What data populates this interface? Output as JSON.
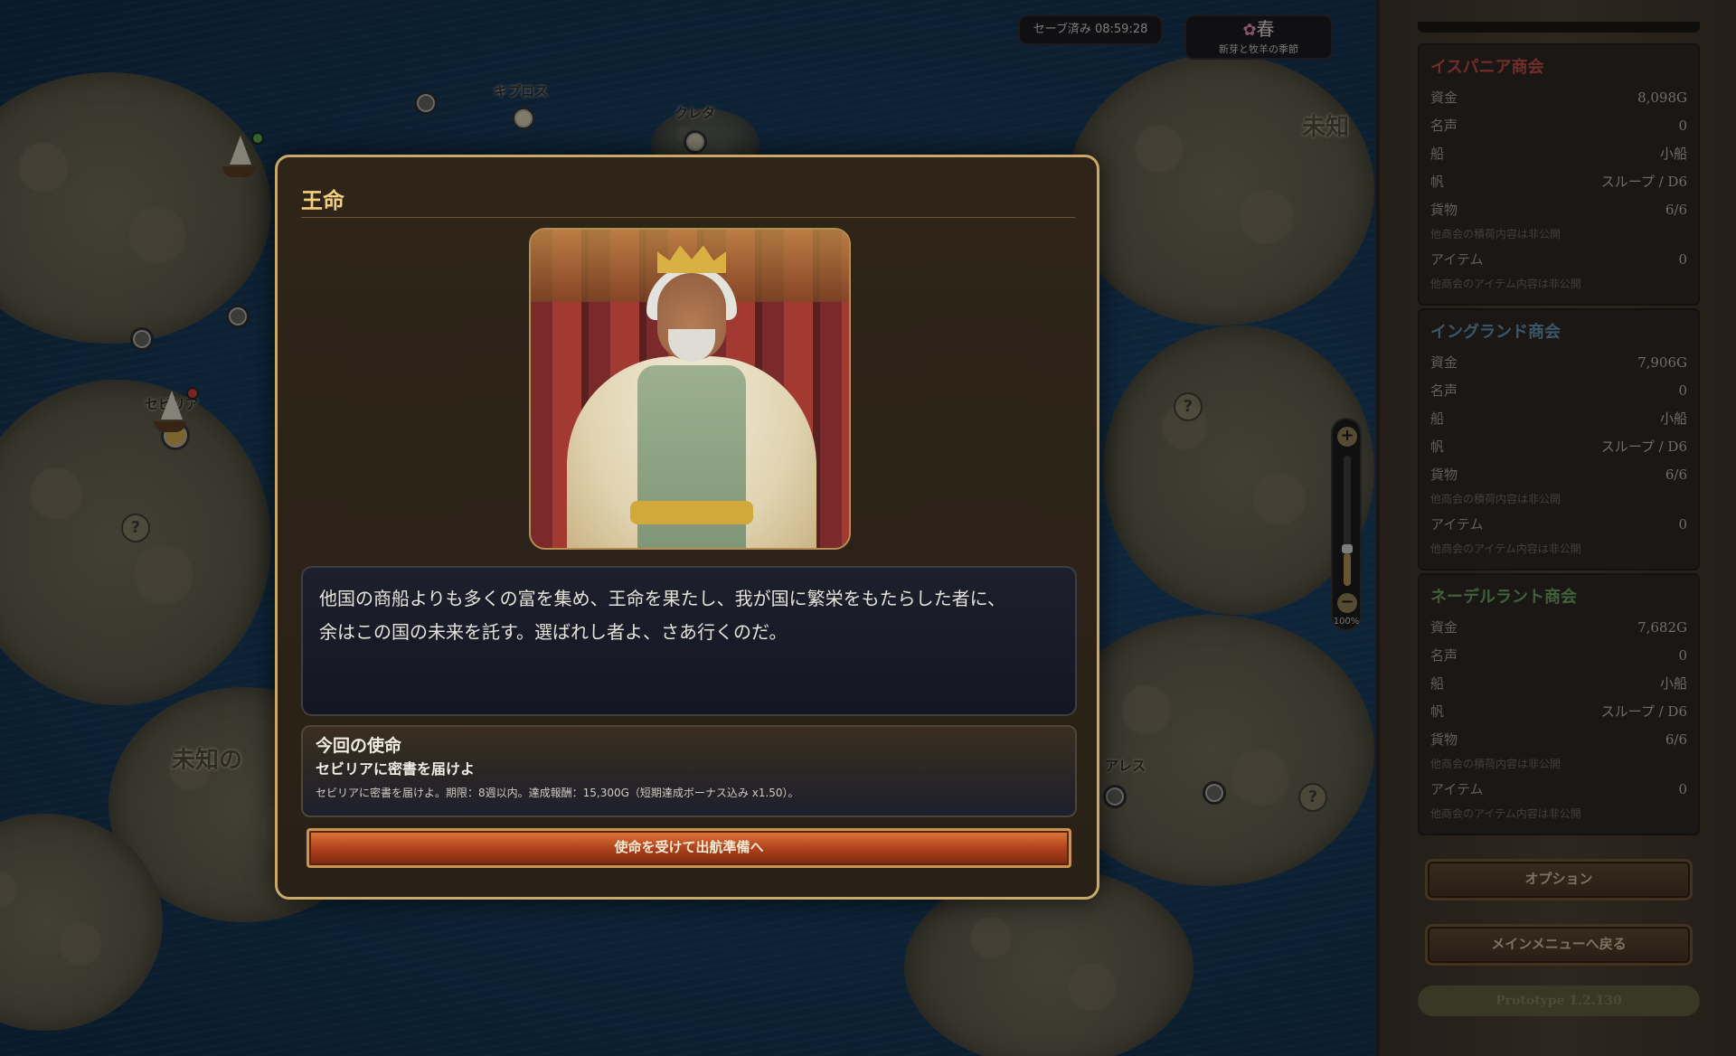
{
  "status": {
    "save_text": "セーブ済み 08:59:28",
    "season_name": "春",
    "season_icon": "flower-icon",
    "season_desc": "新芽と牧羊の季節"
  },
  "map": {
    "labels": {
      "cyprus": "キプロス",
      "crete": "クレタ",
      "seville": "セビリア",
      "unknown": "未知の",
      "unknown_right": "未知",
      "alexandria": "アレス"
    },
    "zoom_level": "100%",
    "zoom_fraction": 0.25
  },
  "modal": {
    "title": "王命",
    "speech_line1": "他国の商船よりも多くの富を集め、王命を果たし、我が国に繁栄をもたらした者に、",
    "speech_line2": "余はこの国の未来を託す。選ばれし者よ、さあ行くのだ。",
    "mission_heading": "今回の使命",
    "mission_name": "セビリアに密書を届けよ",
    "mission_desc": "セビリアに密書を届けよ。期限：8週以内。達成報酬：15,300G（短期達成ボーナス込み x1.50）。",
    "accept_label": "使命を受けて出航準備へ"
  },
  "companies": [
    {
      "name": "イスパニア商会",
      "color": "#b84a45",
      "rows": [
        {
          "k": "資金",
          "v": "8,098G"
        },
        {
          "k": "名声",
          "v": "0"
        },
        {
          "k": "船",
          "v": "小船"
        },
        {
          "k": "帆",
          "v": "スループ / D6"
        },
        {
          "k": "貨物",
          "v": "6/6"
        }
      ],
      "cargo_note": "他商会の積荷内容は非公開",
      "item_label": "アイテム",
      "item_value": "0",
      "item_note": "他商会のアイテム内容は非公開"
    },
    {
      "name": "イングランド商会",
      "color": "#5e8ca8",
      "rows": [
        {
          "k": "資金",
          "v": "7,906G"
        },
        {
          "k": "名声",
          "v": "0"
        },
        {
          "k": "船",
          "v": "小船"
        },
        {
          "k": "帆",
          "v": "スループ / D6"
        },
        {
          "k": "貨物",
          "v": "6/6"
        }
      ],
      "cargo_note": "他商会の積荷内容は非公開",
      "item_label": "アイテム",
      "item_value": "0",
      "item_note": "他商会のアイテム内容は非公開"
    },
    {
      "name": "ネーデルラント商会",
      "color": "#6b9a63",
      "rows": [
        {
          "k": "資金",
          "v": "7,682G"
        },
        {
          "k": "名声",
          "v": "0"
        },
        {
          "k": "船",
          "v": "小船"
        },
        {
          "k": "帆",
          "v": "スループ / D6"
        },
        {
          "k": "貨物",
          "v": "6/6"
        }
      ],
      "cargo_note": "他商会の積荷内容は非公開",
      "item_label": "アイテム",
      "item_value": "0",
      "item_note": "他商会のアイテム内容は非公開"
    }
  ],
  "sidebar": {
    "options_label": "オプション",
    "main_menu_label": "メインメニューへ戻る",
    "version": "Prototype 1.2.130"
  }
}
